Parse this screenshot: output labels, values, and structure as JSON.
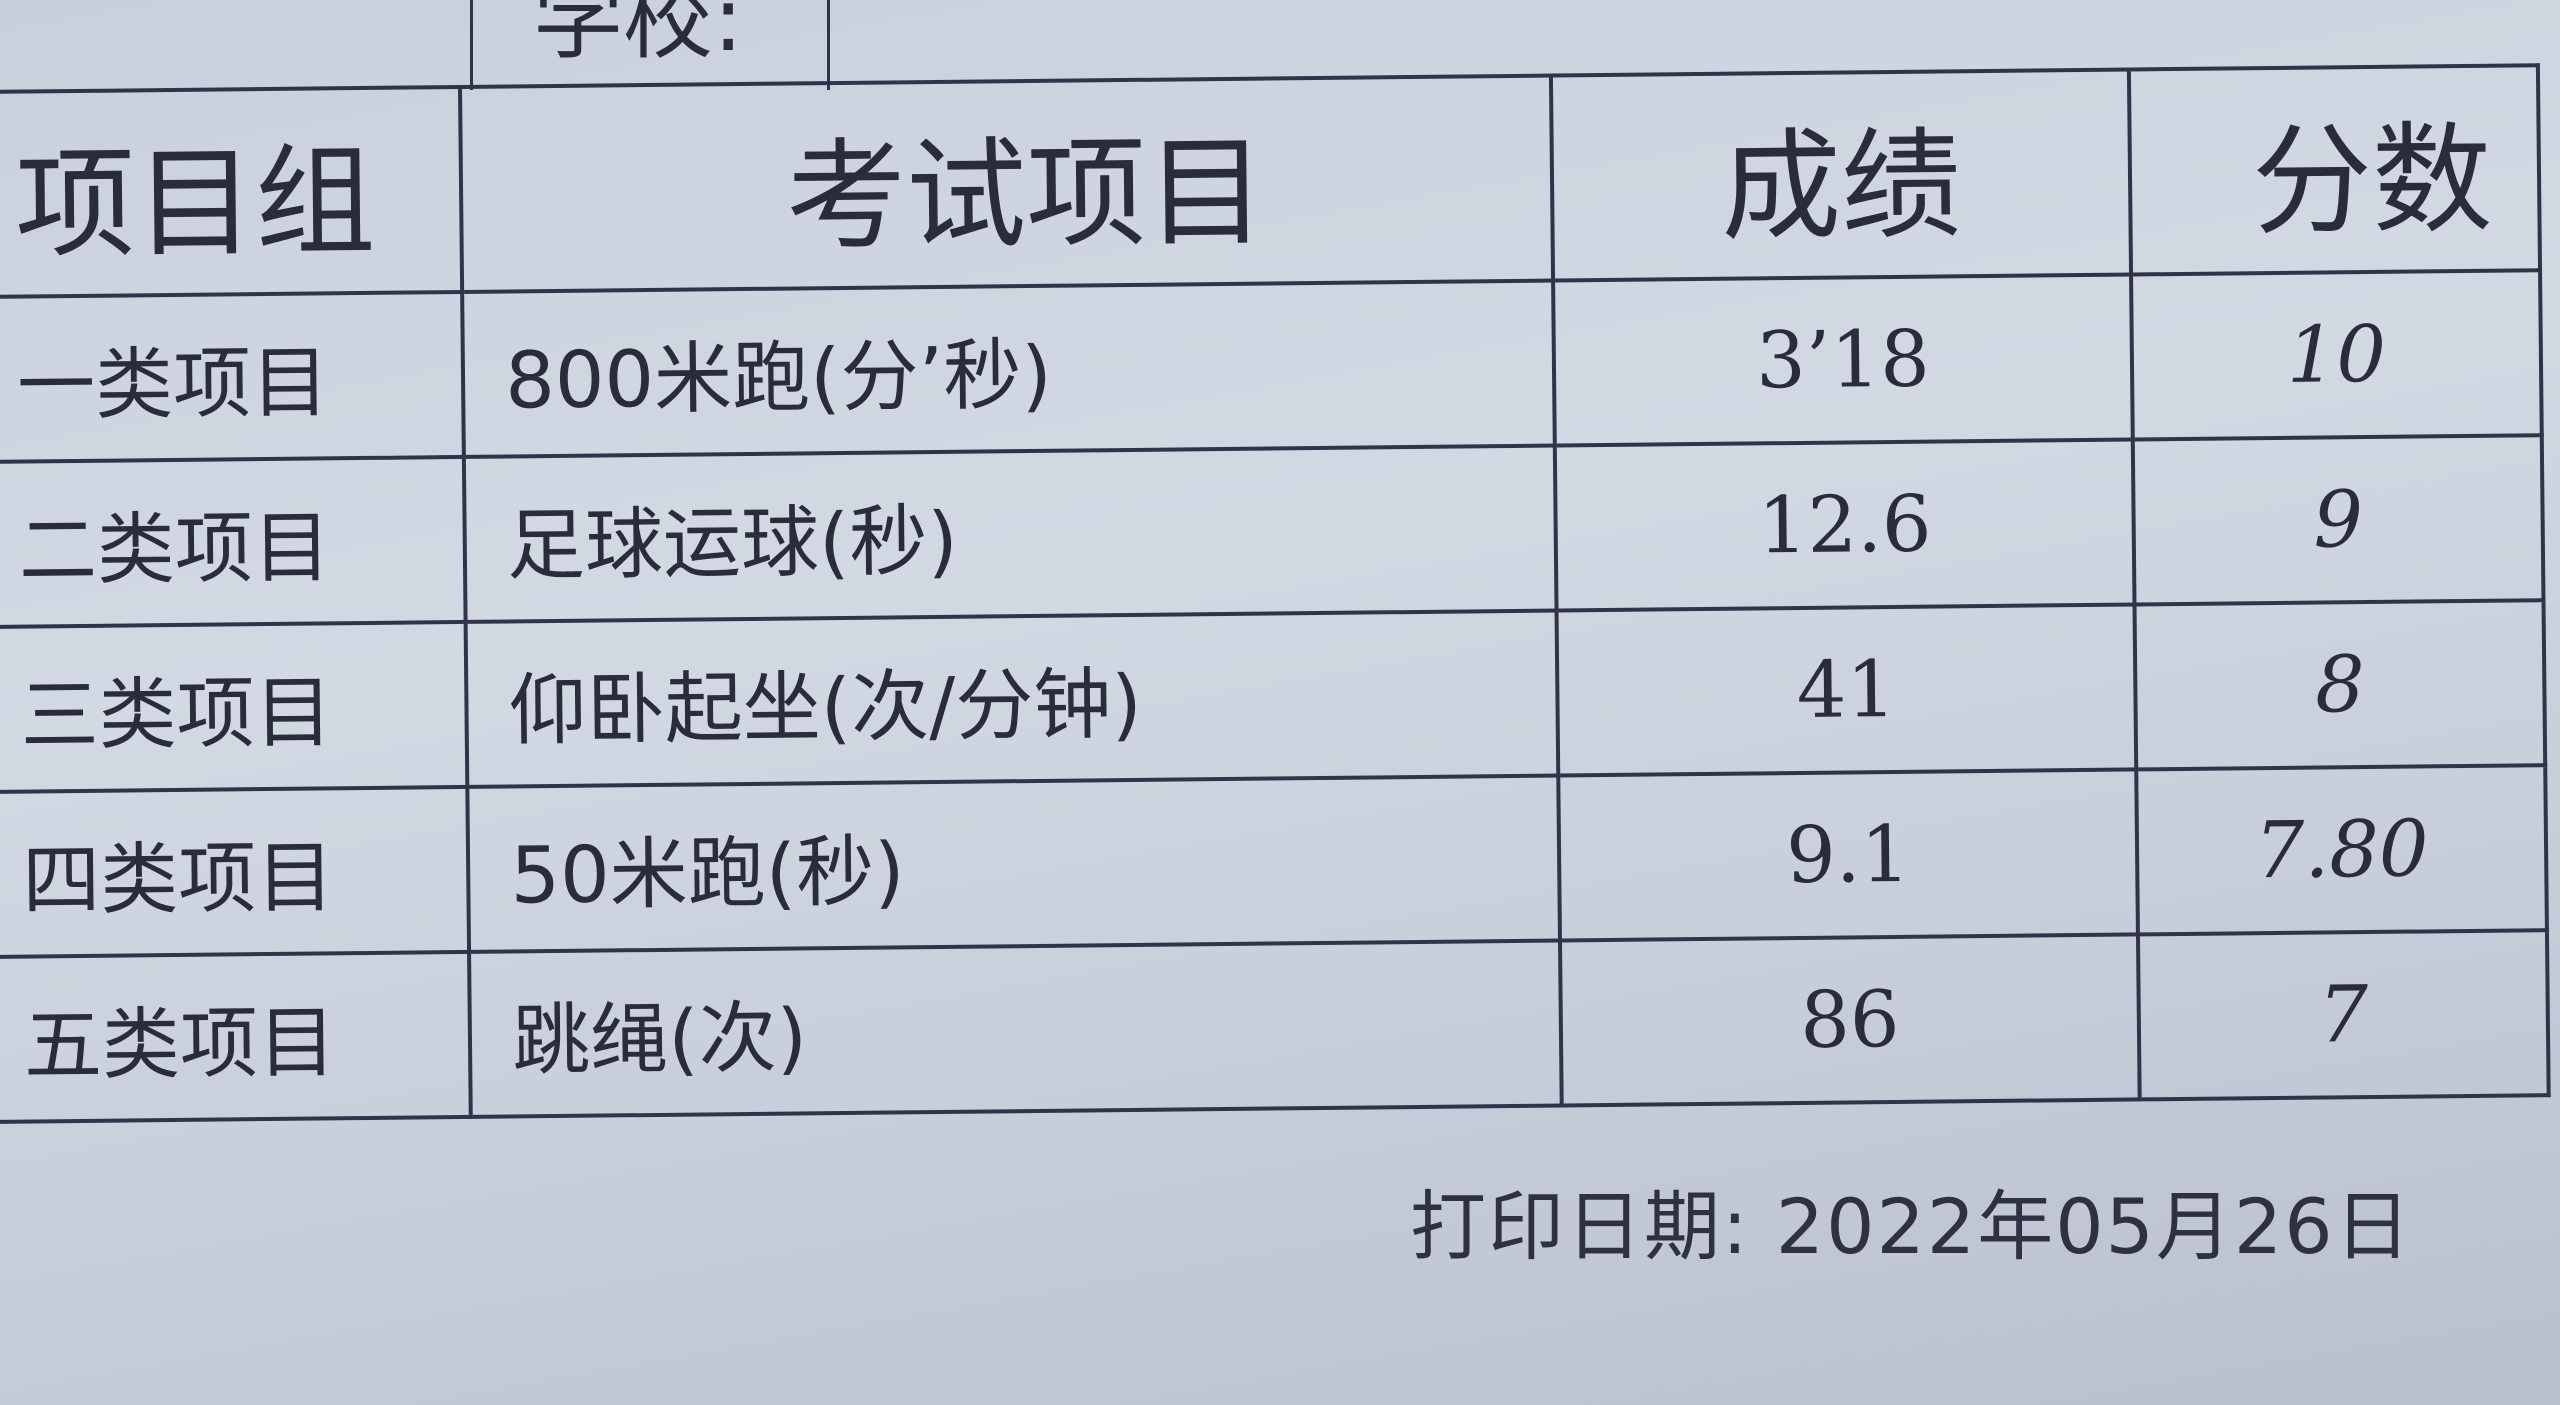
{
  "school_label": "学校:",
  "table": {
    "headers": [
      "项目组",
      "考试项目",
      "成绩",
      "分数"
    ],
    "rows": [
      {
        "group": "一类项目",
        "item": "800米跑(分’秒)",
        "result": "3’18",
        "score": "10"
      },
      {
        "group": "二类项目",
        "item": "足球运球(秒)",
        "result": "12.6",
        "score": "9"
      },
      {
        "group": "三类项目",
        "item": "仰卧起坐(次/分钟)",
        "result": "41",
        "score": "8"
      },
      {
        "group": "四类项目",
        "item": "50米跑(秒)",
        "result": "9.1",
        "score": "7.80"
      },
      {
        "group": "五类项目",
        "item": "跳绳(次)",
        "result": "86",
        "score": "7"
      }
    ]
  },
  "print_date_label": "打印日期:",
  "print_date": "2022年05月26日"
}
